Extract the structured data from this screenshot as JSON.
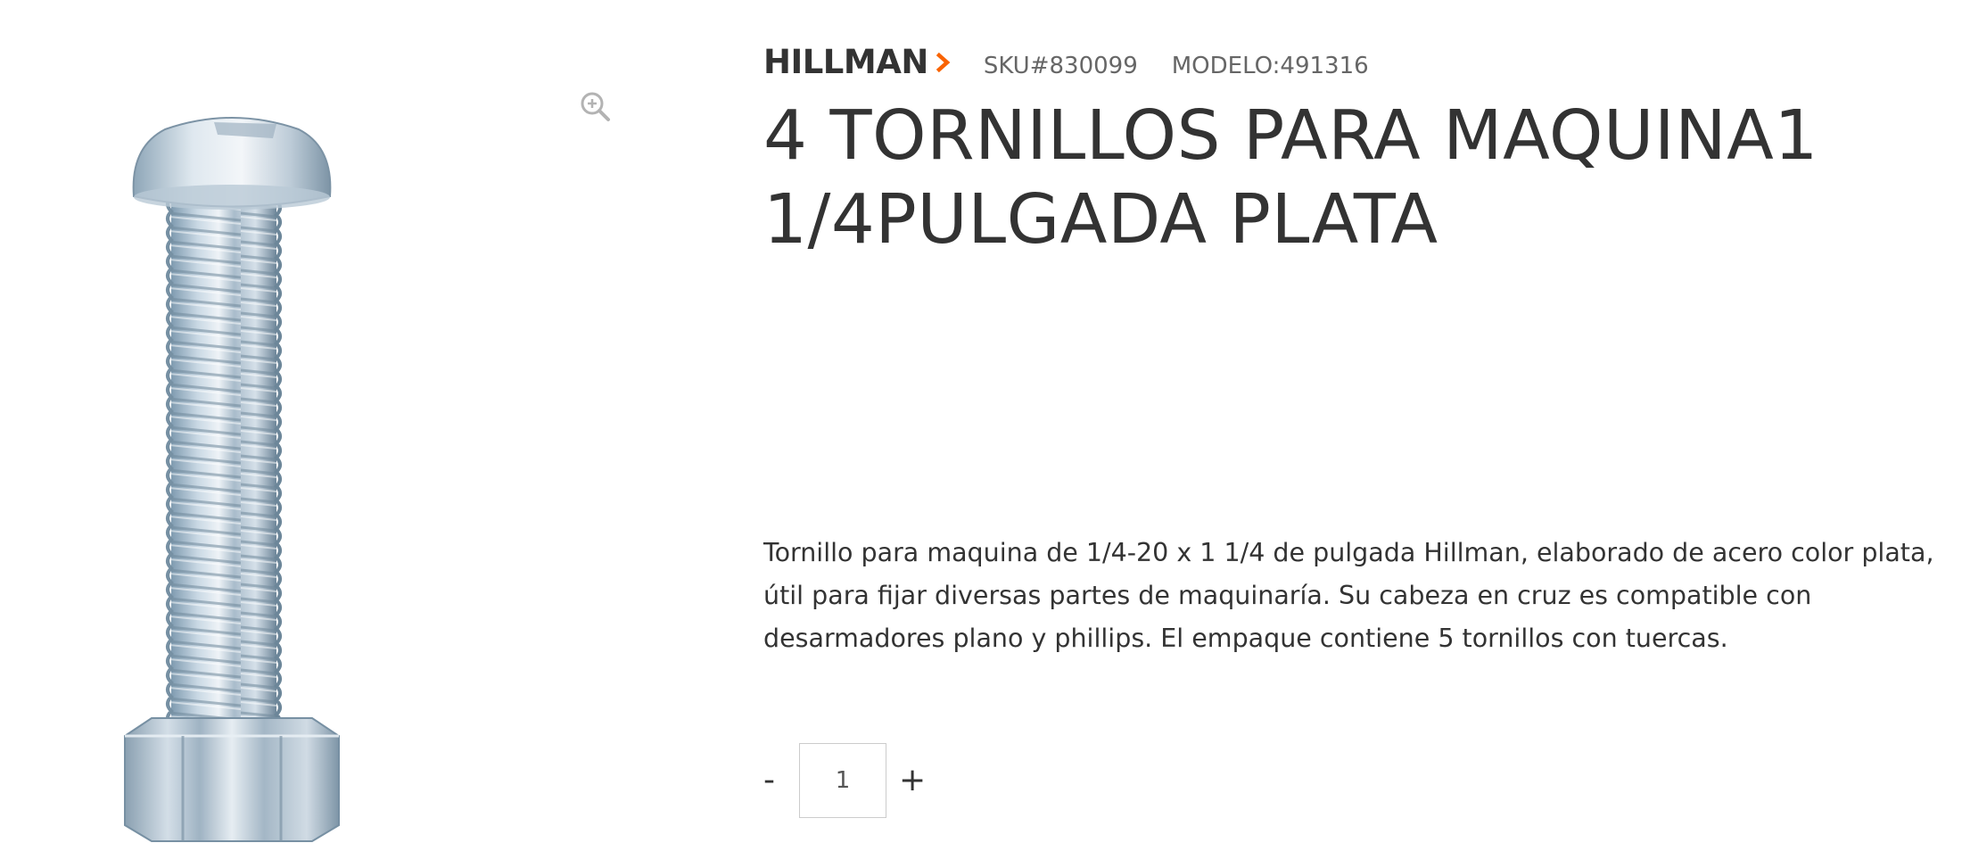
{
  "product": {
    "brand": "HILLMAN",
    "sku": "SKU#830099",
    "model": "MODELO:491316",
    "title": "4 TORNILLOS PARA MAQUINA1 1/4PULGADA PLATA",
    "description": "Tornillo para maquina de 1/4-20 x 1 1/4 de pulgada Hillman, elaborado de acero color plata, útil para fijar diversas partes de maquinaría. Su cabeza en cruz es compatible con desarmadores plano y phillips. El empaque contiene 5 tornillos con tuercas."
  },
  "quantity": {
    "minus_label": "-",
    "value": "1",
    "plus_label": "+"
  },
  "icons": {
    "zoom": "zoom-in-icon",
    "brand_chevron": "chevron-right-icon"
  },
  "colors": {
    "accent": "#f96302",
    "text": "#333333",
    "muted": "#666666",
    "border": "#cccccc"
  }
}
